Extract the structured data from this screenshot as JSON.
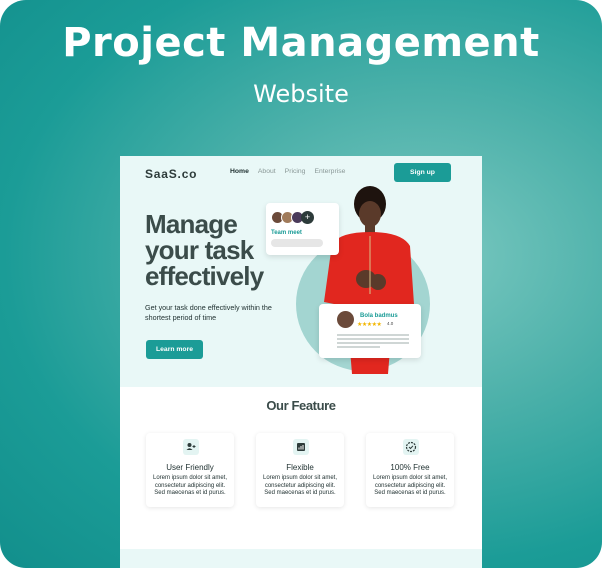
{
  "header": {
    "title": "Project Management",
    "subtitle": "Website"
  },
  "site": {
    "logo": "SaaS.co",
    "nav": [
      "Home",
      "About",
      "Pricing",
      "Enterprise"
    ],
    "signup_label": "Sign up",
    "hero": {
      "title": "Manage your task effectively",
      "subtitle": "Get your task done effectively within the shortest period of time",
      "cta_label": "Learn more"
    },
    "team_card": {
      "label": "Team meet",
      "add_symbol": "+"
    },
    "review_card": {
      "name": "Bola badmus",
      "stars": "★★★★★",
      "rating": "4.0"
    },
    "features": {
      "title": "Our Feature",
      "cards": [
        {
          "icon": "user-add-icon",
          "title": "User Friendly",
          "desc": "Lorem ipsum dolor sit amet, consectetur adipiscing elit. Sed maecenas et id purus."
        },
        {
          "icon": "chart-icon",
          "title": "Flexible",
          "desc": "Lorem ipsum dolor sit amet, consectetur adipiscing elit. Sed maecenas et id purus."
        },
        {
          "icon": "badge-check-icon",
          "title": "100% Free",
          "desc": "Lorem ipsum dolor sit amet, consectetur adipiscing elit. Sed maecenas et id purus."
        }
      ]
    }
  },
  "colors": {
    "accent": "#1b9c97",
    "hero_bg": "#e9f8f7",
    "text_dark": "#3b4c4a"
  }
}
